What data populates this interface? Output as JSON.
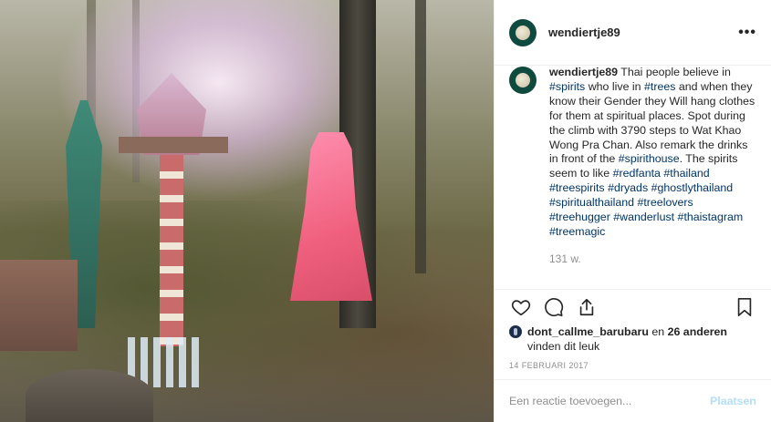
{
  "post": {
    "username": "wendiertje89",
    "more_label": "•••",
    "caption_parts": [
      {
        "text": "Thai people believe in ",
        "tag": false
      },
      {
        "text": "#spirits",
        "tag": true
      },
      {
        "text": " who live in ",
        "tag": false
      },
      {
        "text": "#trees",
        "tag": true
      },
      {
        "text": " and when they know their Gender they Will hang clothes for them at spiritual places. Spot during the climb with 3790 steps to Wat Khao Wong Pra Chan. Also remark the drinks in front of the ",
        "tag": false
      },
      {
        "text": "#spirithouse",
        "tag": true
      },
      {
        "text": ". The spirits seem to like ",
        "tag": false
      },
      {
        "text": "#redfanta",
        "tag": true
      },
      {
        "text": " ",
        "tag": false
      },
      {
        "text": "#thailand",
        "tag": true
      },
      {
        "text": " ",
        "tag": false
      },
      {
        "text": "#treespirits",
        "tag": true
      },
      {
        "text": " ",
        "tag": false
      },
      {
        "text": "#dryads",
        "tag": true
      },
      {
        "text": " ",
        "tag": false
      },
      {
        "text": "#ghostlythailand",
        "tag": true
      },
      {
        "text": " ",
        "tag": false
      },
      {
        "text": "#spiritualthailand",
        "tag": true
      },
      {
        "text": " ",
        "tag": false
      },
      {
        "text": "#treelovers",
        "tag": true
      },
      {
        "text": " ",
        "tag": false
      },
      {
        "text": "#treehugger",
        "tag": true
      },
      {
        "text": " ",
        "tag": false
      },
      {
        "text": "#wanderlust",
        "tag": true
      },
      {
        "text": " ",
        "tag": false
      },
      {
        "text": "#thaistagram",
        "tag": true
      },
      {
        "text": " ",
        "tag": false
      },
      {
        "text": "#treemagic",
        "tag": true
      }
    ],
    "comment_time": "131 w.",
    "likes": {
      "user": "dont_callme_barubaru",
      "middle": " en ",
      "count": "26 anderen",
      "suffix": "vinden dit leuk"
    },
    "date": "14 FEBRUARI 2017",
    "comment_placeholder": "Een reactie toevoegen...",
    "post_button": "Plaatsen"
  },
  "icons": {
    "avatar": "avatar-icon",
    "like": "heart-icon",
    "comment": "comment-icon",
    "share": "share-icon",
    "save": "bookmark-icon"
  },
  "colors": {
    "hashtag": "#003569",
    "post_button_disabled": "#b2dffc",
    "muted": "#8e8e8e",
    "avatar_bg": "#0f4a3e"
  }
}
